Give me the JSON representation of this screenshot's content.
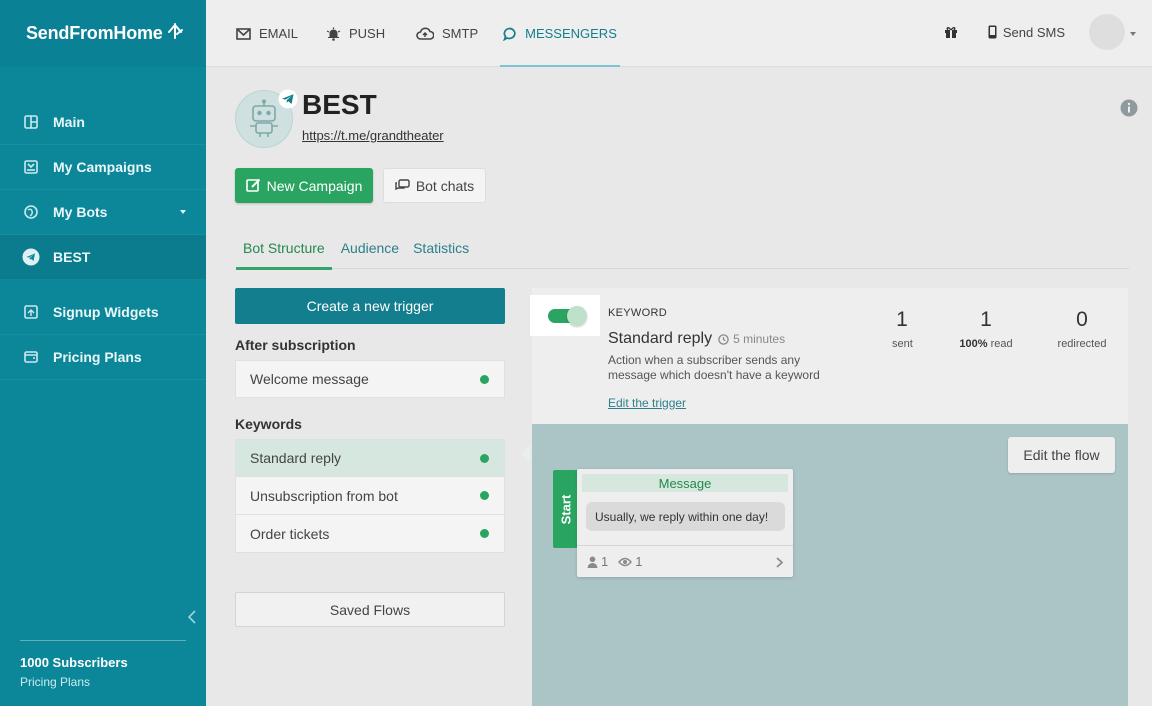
{
  "brand": {
    "name": "SendFromHome"
  },
  "topbar": {
    "tabs": [
      {
        "label": "EMAIL",
        "icon": "email-icon"
      },
      {
        "label": "PUSH",
        "icon": "bell-icon"
      },
      {
        "label": "SMTP",
        "icon": "cloud-upload-icon"
      },
      {
        "label": "MESSENGERS",
        "icon": "chat-icon"
      }
    ],
    "active_tab": "MESSENGERS",
    "send_sms_label": "Send SMS"
  },
  "sidebar": {
    "items": [
      {
        "label": "Main",
        "icon": "dashboard-icon"
      },
      {
        "label": "My Campaigns",
        "icon": "campaigns-icon"
      },
      {
        "label": "My Bots",
        "icon": "globe-icon"
      },
      {
        "label": "BEST",
        "icon": "telegram-icon"
      },
      {
        "label": "Signup Widgets",
        "icon": "widget-icon"
      },
      {
        "label": "Pricing Plans",
        "icon": "wallet-icon"
      }
    ],
    "active_item": "BEST",
    "footer": {
      "subscribers": "1000 Subscribers",
      "plan_link": "Pricing Plans"
    }
  },
  "bot": {
    "name": "BEST",
    "link": "https://t.me/grandtheater"
  },
  "actions": {
    "new_campaign": "New Campaign",
    "bot_chats": "Bot chats"
  },
  "subtabs": [
    "Bot Structure",
    "Audience",
    "Statistics"
  ],
  "active_subtab": "Bot Structure",
  "left": {
    "create_trigger": "Create a new trigger",
    "after_subscription_title": "After subscription",
    "after_subscription_items": [
      {
        "label": "Welcome message",
        "status": "active"
      }
    ],
    "keywords_title": "Keywords",
    "keyword_items": [
      {
        "label": "Standard reply",
        "status": "active",
        "selected": true
      },
      {
        "label": "Unsubscription from bot",
        "status": "active"
      },
      {
        "label": "Order tickets",
        "status": "active"
      }
    ],
    "saved_flows": "Saved Flows"
  },
  "trigger": {
    "enabled": true,
    "type_label": "KEYWORD",
    "title": "Standard reply",
    "delay": "5 minutes",
    "description": "Action when a subscriber sends any message which doesn't have a keyword",
    "edit_link": "Edit the trigger",
    "stats": [
      {
        "value": "1",
        "label": "sent"
      },
      {
        "value": "1",
        "label_bold": "100%",
        "label": "read"
      },
      {
        "value": "0",
        "label": "redirected"
      }
    ]
  },
  "flow": {
    "edit_button": "Edit the flow",
    "start_label": "Start",
    "message_card": {
      "header": "Message",
      "text": "Usually, we reply within one day!",
      "subscribers": "1",
      "views": "1"
    }
  },
  "colors": {
    "sidebar": "#0b8799",
    "accent_green": "#2aa561",
    "accent_teal": "#137e8e"
  }
}
